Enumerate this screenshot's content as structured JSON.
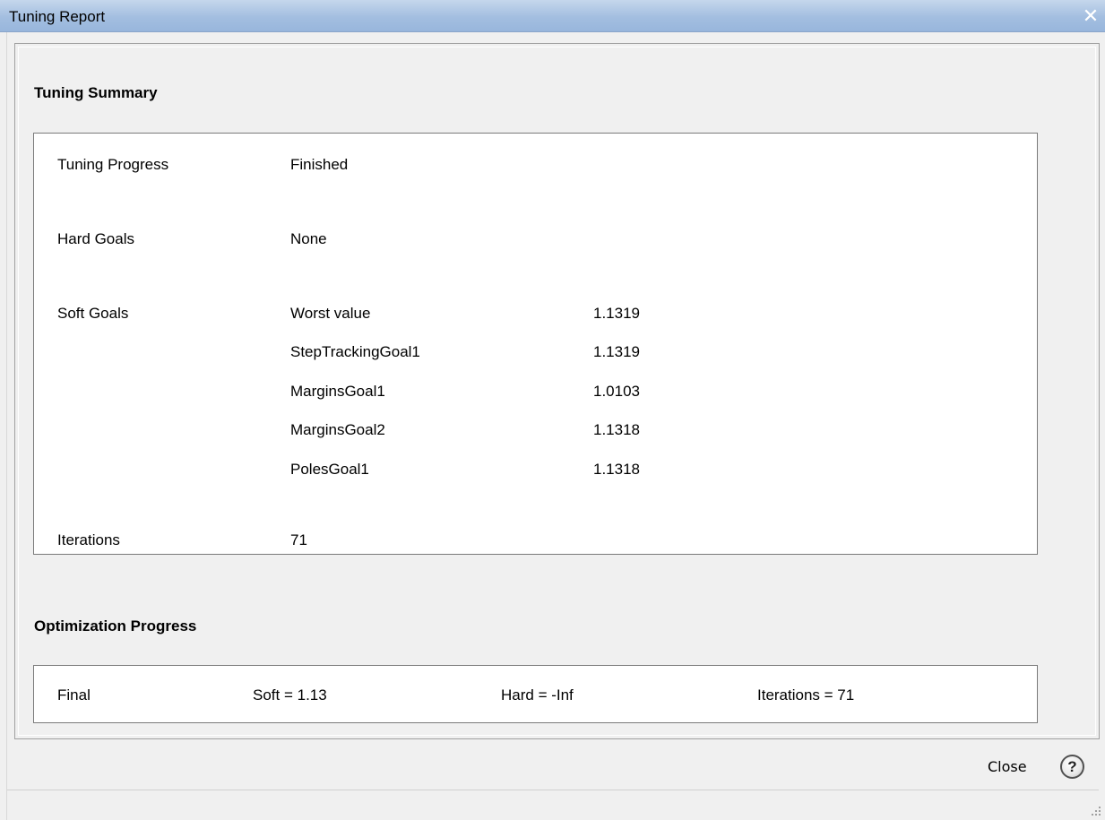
{
  "window": {
    "title": "Tuning Report",
    "close_glyph": "✕"
  },
  "summary": {
    "heading": "Tuning Summary",
    "progress": {
      "label": "Tuning Progress",
      "value": "Finished"
    },
    "hard_goals": {
      "label": "Hard Goals",
      "value": "None"
    },
    "soft_goals": {
      "label": "Soft Goals",
      "rows": [
        {
          "name": "Worst value",
          "value": "1.1319"
        },
        {
          "name": "StepTrackingGoal1",
          "value": "1.1319"
        },
        {
          "name": "MarginsGoal1",
          "value": "1.0103"
        },
        {
          "name": "MarginsGoal2",
          "value": "1.1318"
        },
        {
          "name": "PolesGoal1",
          "value": "1.1318"
        }
      ]
    },
    "iterations": {
      "label": "Iterations",
      "value": "71"
    }
  },
  "optimization": {
    "heading": "Optimization Progress",
    "label": "Final",
    "soft": "Soft = 1.13",
    "hard": "Hard = -Inf",
    "iterations": "Iterations = 71"
  },
  "footer": {
    "close_label": "Close",
    "help_glyph": "?"
  },
  "icons": {
    "close": "close-icon",
    "help": "help-icon",
    "resize": "resize-grip-icon"
  }
}
